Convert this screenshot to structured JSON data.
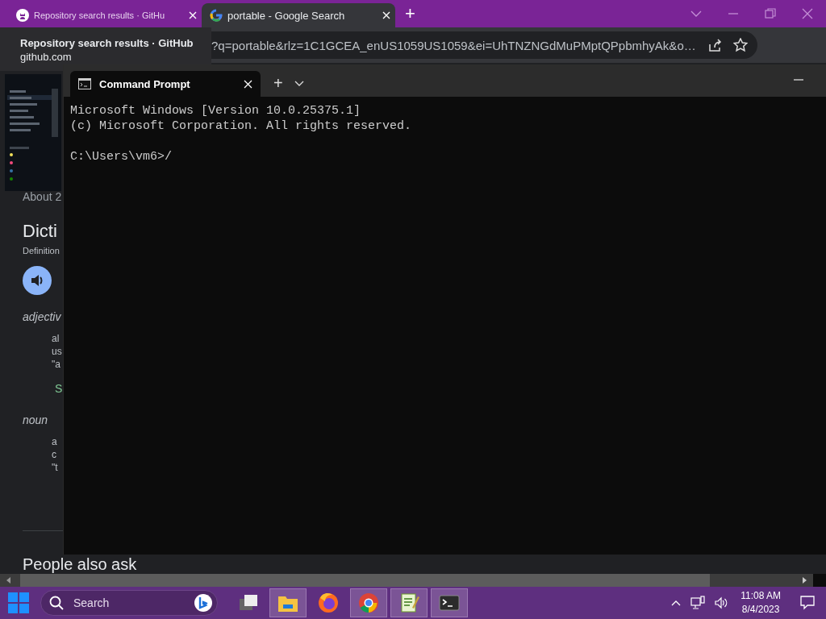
{
  "browser": {
    "tabs": [
      {
        "title": "Repository search results · GitHu",
        "selected": false
      },
      {
        "title": "portable - Google Search",
        "selected": true
      }
    ],
    "new_tab": "+",
    "address": "?q=portable&rlz=1C1GCEA_enUS1059US1059&ei=UhTNZNGdMuPMptQPpbmhyAk&o…",
    "tab_hover_card": {
      "title": "Repository search results · GitHub",
      "url": "github.com"
    },
    "page": [
      {
        "kind": "meta",
        "text": "About 2"
      },
      {
        "kind": "heading",
        "text": "Dicti"
      },
      {
        "kind": "small",
        "text": "Definition"
      },
      {
        "kind": "speaker"
      },
      {
        "kind": "pos",
        "text": "adjectiv"
      },
      {
        "kind": "def",
        "text": "al"
      },
      {
        "kind": "def",
        "text": "us"
      },
      {
        "kind": "def",
        "text": "\"a"
      },
      {
        "kind": "synonym",
        "text": "S"
      },
      {
        "kind": "pos",
        "text": "noun"
      },
      {
        "kind": "def",
        "text": "a"
      },
      {
        "kind": "def",
        "text": "c"
      },
      {
        "kind": "def",
        "text": "\"t"
      },
      {
        "kind": "rule"
      },
      {
        "kind": "section",
        "text": "People also ask"
      }
    ]
  },
  "terminal": {
    "tabs": [
      {
        "title": "Command Prompt",
        "selected": true
      }
    ],
    "new_tab": "+",
    "blocks": [
      [
        "Microsoft Windows [Version 10.0.25375.1]",
        "(c) Microsoft Corporation. All rights reserved."
      ],
      [
        "C:\\Users\\vm6>/"
      ]
    ]
  },
  "taskbar": {
    "search_placeholder": "Search",
    "apps": [
      {
        "kind": "taskview",
        "open": false
      },
      {
        "kind": "explorer",
        "open": true
      },
      {
        "kind": "firefox",
        "open": false
      },
      {
        "kind": "chrome",
        "open": true
      },
      {
        "kind": "notepad",
        "open": true
      },
      {
        "kind": "terminal",
        "open": true
      }
    ],
    "time": "11:08 AM",
    "date": "8/4/2023"
  }
}
